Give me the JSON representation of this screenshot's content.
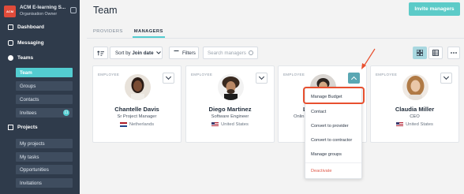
{
  "sidebar": {
    "brand_title": "ACM E-learning S...",
    "brand_sub": "Organisation Owner",
    "logo_text": "ACM",
    "sections": {
      "dashboard": "Dashboard",
      "messaging": "Messaging",
      "teams": "Teams",
      "projects": "Projects"
    },
    "team_items": [
      "Team",
      "Groups",
      "Contacts",
      "Invitees"
    ],
    "invitees_badge": "11",
    "project_items": [
      "My projects",
      "My tasks",
      "Opportunities",
      "Invitations"
    ]
  },
  "header": {
    "title": "Team",
    "invite_button": "Invite managers"
  },
  "tabs": [
    "PROVIDERS",
    "MANAGERS"
  ],
  "toolbar": {
    "sort_prefix": "Sort by",
    "sort_value": "Join date",
    "filters_label": "Filters",
    "search_placeholder": "Search managers"
  },
  "cards": [
    {
      "type": "EMPLOYEE",
      "name": "Chantelle Davis",
      "role": "Sr Project Manager",
      "location": "Netherlands",
      "flag": "nl"
    },
    {
      "type": "EMPLOYEE",
      "name": "Diego Martinez",
      "role": "Software Engineer",
      "location": "United States",
      "flag": "us"
    },
    {
      "type": "EMPLOYEE",
      "name": "Li",
      "role": "Onlin",
      "location": "",
      "flag": ""
    },
    {
      "type": "EMPLOYEE",
      "name": "Claudia Miller",
      "role": "CEO",
      "location": "United States",
      "flag": "us"
    }
  ],
  "menu": {
    "items": [
      "Manage Budget",
      "Contact",
      "Convert to provider",
      "Convert to contractor",
      "Manage groups"
    ],
    "danger_item": "Deactivate"
  },
  "colors": {
    "accent": "#53cdd1",
    "sidebar": "#2f3b4b",
    "highlight": "#e8502f",
    "danger": "#e05a4a"
  }
}
